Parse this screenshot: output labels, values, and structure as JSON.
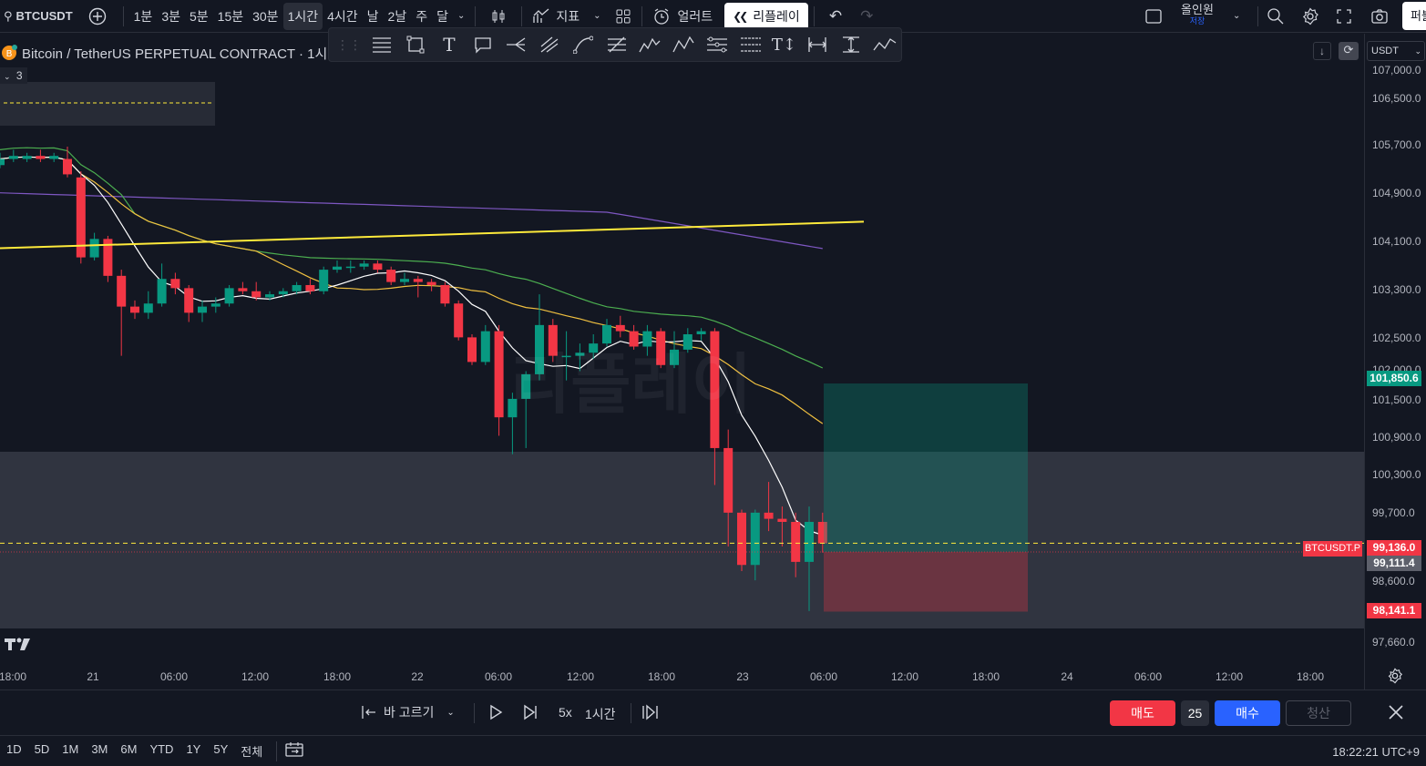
{
  "topbar": {
    "symbol": "BTCUSDT",
    "timeframes": [
      "1분",
      "3분",
      "5분",
      "15분",
      "30분",
      "1시간",
      "4시간",
      "날",
      "2날",
      "주",
      "달"
    ],
    "active_timeframe": "1시간",
    "indicators_label": "지표",
    "alert_label": "얼러트",
    "replay_label": "리플레이",
    "layout_name": "올인원",
    "layout_sub": "저장",
    "publish_label": "퍼블"
  },
  "chart": {
    "title": "Bitcoin / TetherUS PERPETUAL CONTRACT · 1시",
    "indicator_count": "3",
    "currency": "USDT",
    "watermark": "리플레이",
    "price_labels": [
      "107,000.0",
      "106,500.0",
      "105,700.0",
      "104,900.0",
      "104,100.0",
      "103,300.0",
      "102,500.0",
      "102,000.0",
      "101,500.0",
      "100,900.0",
      "100,300.0",
      "99,700.0",
      "98,600.0",
      "97,660.0"
    ],
    "tags": {
      "target": "101,850.6",
      "symbol_tag": "BTCUSDT.P",
      "current": "99,136.0",
      "entry": "99,111.4",
      "stop": "98,141.1"
    },
    "time_labels": [
      "18:00",
      "21",
      "06:00",
      "12:00",
      "18:00",
      "22",
      "06:00",
      "12:00",
      "18:00",
      "23",
      "06:00",
      "12:00",
      "18:00",
      "24",
      "06:00",
      "12:00",
      "18:00"
    ],
    "colors": {
      "up": "#089981",
      "down": "#f23645",
      "trendline": "#ffeb3b",
      "ma_white": "#ffffff",
      "ma_yellow": "#f0c040",
      "ma_green": "#4caf50",
      "ma_purple": "#7e57c2"
    }
  },
  "chart_data": {
    "type": "candlestick",
    "interval": "1시간",
    "candles_approx": [
      {
        "o": 105400,
        "c": 105500,
        "h": 105600,
        "l": 105350
      },
      {
        "o": 105500,
        "c": 105550,
        "h": 105650,
        "l": 105450
      },
      {
        "o": 105500,
        "c": 105550,
        "h": 105600,
        "l": 105450
      },
      {
        "o": 105550,
        "c": 105500,
        "h": 105650,
        "l": 105450
      },
      {
        "o": 105500,
        "c": 105550,
        "h": 105600,
        "l": 105450
      },
      {
        "o": 105500,
        "c": 105250,
        "h": 105700,
        "l": 105200
      },
      {
        "o": 105200,
        "c": 103900,
        "h": 105300,
        "l": 103800
      },
      {
        "o": 103900,
        "c": 104200,
        "h": 104300,
        "l": 103850
      },
      {
        "o": 104200,
        "c": 103600,
        "h": 104250,
        "l": 103500
      },
      {
        "o": 103600,
        "c": 103100,
        "h": 103700,
        "l": 102300
      },
      {
        "o": 103100,
        "c": 103000,
        "h": 103200,
        "l": 102900
      },
      {
        "o": 103000,
        "c": 103150,
        "h": 103350,
        "l": 102900
      },
      {
        "o": 103150,
        "c": 103550,
        "h": 103800,
        "l": 103100
      },
      {
        "o": 103550,
        "c": 103400,
        "h": 103650,
        "l": 103300
      },
      {
        "o": 103400,
        "c": 103000,
        "h": 103450,
        "l": 102850
      },
      {
        "o": 103000,
        "c": 103100,
        "h": 103200,
        "l": 102850
      },
      {
        "o": 103100,
        "c": 103150,
        "h": 103250,
        "l": 103000
      },
      {
        "o": 103150,
        "c": 103400,
        "h": 103450,
        "l": 103100
      },
      {
        "o": 103400,
        "c": 103350,
        "h": 103500,
        "l": 103300
      },
      {
        "o": 103350,
        "c": 103250,
        "h": 103500,
        "l": 103200
      },
      {
        "o": 103250,
        "c": 103300,
        "h": 103350,
        "l": 103200
      },
      {
        "o": 103300,
        "c": 103350,
        "h": 103400,
        "l": 103250
      },
      {
        "o": 103350,
        "c": 103450,
        "h": 103500,
        "l": 103300
      },
      {
        "o": 103450,
        "c": 103350,
        "h": 103550,
        "l": 103300
      },
      {
        "o": 103350,
        "c": 103700,
        "h": 103750,
        "l": 103300
      },
      {
        "o": 103700,
        "c": 103750,
        "h": 103850,
        "l": 103650
      },
      {
        "o": 103750,
        "c": 103750,
        "h": 103850,
        "l": 103650
      },
      {
        "o": 103750,
        "c": 103800,
        "h": 103850,
        "l": 103700
      },
      {
        "o": 103800,
        "c": 103700,
        "h": 103850,
        "l": 103650
      },
      {
        "o": 103700,
        "c": 103500,
        "h": 103750,
        "l": 103450
      },
      {
        "o": 103500,
        "c": 103550,
        "h": 103650,
        "l": 103450
      },
      {
        "o": 103550,
        "c": 103500,
        "h": 103600,
        "l": 103250
      },
      {
        "o": 103500,
        "c": 103450,
        "h": 103550,
        "l": 103350
      },
      {
        "o": 103450,
        "c": 103150,
        "h": 103500,
        "l": 103100
      },
      {
        "o": 103150,
        "c": 102600,
        "h": 103200,
        "l": 102550
      },
      {
        "o": 102600,
        "c": 102200,
        "h": 102650,
        "l": 102150
      },
      {
        "o": 102200,
        "c": 102700,
        "h": 102800,
        "l": 102150
      },
      {
        "o": 102700,
        "c": 101300,
        "h": 102800,
        "l": 101000
      },
      {
        "o": 101300,
        "c": 101600,
        "h": 101700,
        "l": 100700
      },
      {
        "o": 101600,
        "c": 102000,
        "h": 102050,
        "l": 100800
      },
      {
        "o": 102000,
        "c": 102800,
        "h": 103300,
        "l": 101900
      },
      {
        "o": 102800,
        "c": 102300,
        "h": 102900,
        "l": 102200
      },
      {
        "o": 102300,
        "c": 102300,
        "h": 102700,
        "l": 101900
      },
      {
        "o": 102300,
        "c": 102350,
        "h": 102500,
        "l": 102050
      },
      {
        "o": 102350,
        "c": 102500,
        "h": 102650,
        "l": 102250
      },
      {
        "o": 102500,
        "c": 102800,
        "h": 102900,
        "l": 102450
      },
      {
        "o": 102800,
        "c": 102700,
        "h": 102950,
        "l": 102600
      },
      {
        "o": 102700,
        "c": 102450,
        "h": 102800,
        "l": 102400
      },
      {
        "o": 102450,
        "c": 102700,
        "h": 102800,
        "l": 102300
      },
      {
        "o": 102700,
        "c": 102150,
        "h": 102750,
        "l": 102100
      },
      {
        "o": 102150,
        "c": 102400,
        "h": 102700,
        "l": 102100
      },
      {
        "o": 102400,
        "c": 102650,
        "h": 102750,
        "l": 102350
      },
      {
        "o": 102650,
        "c": 102700,
        "h": 102750,
        "l": 102550
      },
      {
        "o": 102700,
        "c": 100800,
        "h": 102750,
        "l": 100200
      },
      {
        "o": 100800,
        "c": 99750,
        "h": 101100,
        "l": 99200
      },
      {
        "o": 99750,
        "c": 98900,
        "h": 99800,
        "l": 98800
      },
      {
        "o": 98900,
        "c": 99750,
        "h": 99800,
        "l": 98650
      },
      {
        "o": 99750,
        "c": 99650,
        "h": 100250,
        "l": 99450
      },
      {
        "o": 99650,
        "c": 99600,
        "h": 99850,
        "l": 99200
      },
      {
        "o": 99600,
        "c": 98950,
        "h": 99750,
        "l": 98700
      },
      {
        "o": 98950,
        "c": 99600,
        "h": 99850,
        "l": 98150
      },
      {
        "o": 99600,
        "c": 99250,
        "h": 99750,
        "l": 99100
      }
    ],
    "position": {
      "target": 101850.6,
      "entry": 99111.4,
      "stop": 98141.1,
      "current": 99136.0
    },
    "trendline": {
      "from": 104050,
      "to": 104480
    },
    "yrange": [
      97500,
      107050
    ]
  },
  "replay": {
    "select_bar_label": "바 고르기",
    "speed": "5x",
    "interval": "1시간",
    "sell_label": "매도",
    "qty": "25",
    "buy_label": "매수",
    "close_label": "청산"
  },
  "footer": {
    "ranges": [
      "1D",
      "5D",
      "1M",
      "3M",
      "6M",
      "YTD",
      "1Y",
      "5Y",
      "전체"
    ],
    "clock": "18:22:21 UTC+9"
  }
}
